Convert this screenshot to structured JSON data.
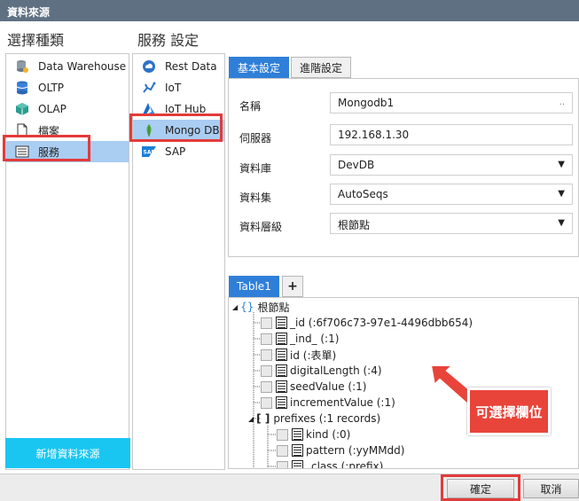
{
  "title": "資料來源",
  "left_header": "選擇種類",
  "mid_header": "服務 設定",
  "categories": [
    {
      "label": "Data Warehouse",
      "icon": "database-stack-icon"
    },
    {
      "label": "OLTP",
      "icon": "database-icon"
    },
    {
      "label": "OLAP",
      "icon": "cube-icon"
    },
    {
      "label": "檔案",
      "icon": "file-icon"
    },
    {
      "label": "服務",
      "icon": "service-list-icon"
    }
  ],
  "services": [
    {
      "label": "Rest Data",
      "icon": "cloud-icon"
    },
    {
      "label": "IoT",
      "icon": "iot-icon"
    },
    {
      "label": "IoT Hub",
      "icon": "azure-icon"
    },
    {
      "label": "Mongo DB",
      "icon": "mongodb-leaf-icon"
    },
    {
      "label": "SAP",
      "icon": "sap-icon"
    }
  ],
  "add_source_label": "新增資料來源",
  "tabs": {
    "basic": "基本設定",
    "advanced": "進階設定"
  },
  "form": {
    "name_label": "名稱",
    "name_value": "Mongodb1",
    "name_btn": "..",
    "server_label": "伺服器",
    "server_value": "192.168.1.30",
    "db_label": "資料庫",
    "db_value": "DevDB",
    "collection_label": "資料集",
    "collection_value": "AutoSeqs",
    "level_label": "資料層級",
    "level_value": "根節點"
  },
  "table_tab": "Table1",
  "add_tab": "+",
  "tree": {
    "root": "根節點",
    "nodes": [
      "_id (:6f706c73-97e1-4496dbb654)",
      "_ind_ (:1)",
      "id (:表單)",
      "digitalLength (:4)",
      "seedValue (:1)",
      "incrementValue (:1)"
    ],
    "prefixes": "prefixes (:1 records)",
    "children": [
      "kind (:0)",
      "pattern (:yyMMdd)",
      "_class (:prefix)"
    ]
  },
  "callout": "可選擇欄位",
  "ok_label": "確定",
  "cancel_label": "取消",
  "colors": {
    "accent": "#2f7fd8",
    "selection": "#aacdf2",
    "highlight": "#e33b3b",
    "add_button": "#19c6f2"
  }
}
